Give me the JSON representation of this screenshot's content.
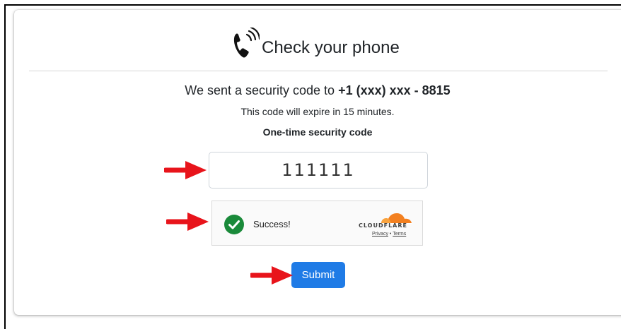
{
  "header": {
    "title": "Check your phone",
    "icon": "phone-ringing-icon"
  },
  "message": {
    "sent_prefix": "We sent a security code to ",
    "phone_number": "+1 (xxx) xxx - 8815",
    "expire_text": "This code will expire in 15 minutes."
  },
  "code_field": {
    "label": "One-time security code",
    "value": "111111"
  },
  "captcha": {
    "status": "Success!",
    "provider": "CLOUDFLARE",
    "privacy_label": "Privacy",
    "separator": "•",
    "terms_label": "Terms",
    "check_color": "#1a8a3a",
    "logo_color": "#f38020"
  },
  "submit": {
    "label": "Submit",
    "color": "#1f7be6"
  },
  "annotations": {
    "arrow_color": "#e8141b"
  }
}
